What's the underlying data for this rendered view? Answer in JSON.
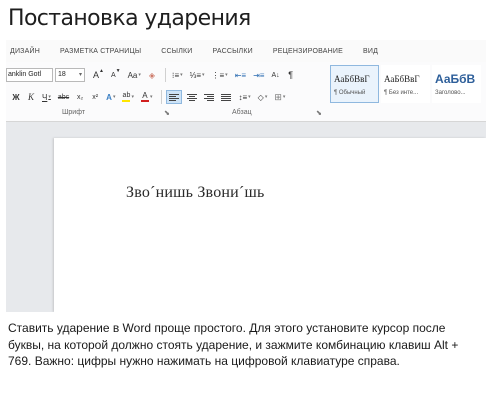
{
  "header": {
    "title": "Постановка ударения"
  },
  "ribbon": {
    "tabs": [
      "ДИЗАЙН",
      "РАЗМЕТКА СТРАНИЦЫ",
      "ССЫЛКИ",
      "РАССЫЛКИ",
      "РЕЦЕНЗИРОВАНИЕ",
      "ВИД"
    ],
    "font_name": "anklin Gotl",
    "font_size": "18",
    "grow_font": "A",
    "shrink_font": "A",
    "change_case": "Aa",
    "sort": "A↓",
    "pilcrow": "¶",
    "bold": "Ж",
    "italic": "К",
    "underline": "Ч",
    "strikethrough": "abc",
    "subscript": "x₂",
    "superscript": "x²",
    "highlight_glyph": "ab",
    "font_color_glyph": "A",
    "group_font_label": "Шрифт",
    "group_paragraph_label": "Абзац",
    "styles": [
      {
        "sample": "АаБбВвГ",
        "name": "¶ Обычный",
        "active": true
      },
      {
        "sample": "АаБбВвГ",
        "name": "¶ Без инте...",
        "active": false
      },
      {
        "sample": "АаБбВ",
        "name": "Заголово...",
        "active": false
      }
    ]
  },
  "document": {
    "text": "Зво´нишь Звони´шь"
  },
  "caption": {
    "text": "Ставить ударение в Word проще простого. Для этого установите курсор после буквы, на которой должно стоять ударение, и зажмите комбинацию клавиш Alt + 769. Важно: цифры нужно нажимать на цифровой клавиатуре справа."
  },
  "colors": {
    "highlight": "#ffe600",
    "font_color": "#d11f1f",
    "selected_button": "#cde3f7",
    "heading_style": "#2e5f9a"
  }
}
